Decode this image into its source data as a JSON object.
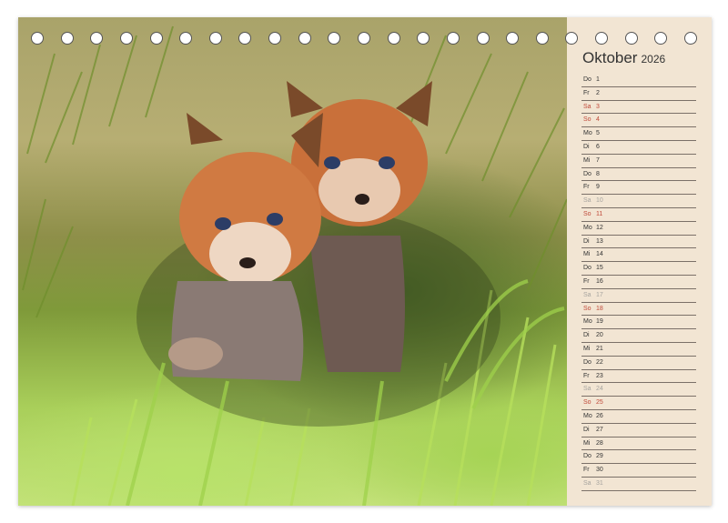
{
  "calendar": {
    "month": "Oktober",
    "year": "2026",
    "days": [
      {
        "name": "Do",
        "num": "1",
        "type": "weekday"
      },
      {
        "name": "Fr",
        "num": "2",
        "type": "weekday"
      },
      {
        "name": "Sa",
        "num": "3",
        "type": "sat"
      },
      {
        "name": "So",
        "num": "4",
        "type": "sun"
      },
      {
        "name": "Mo",
        "num": "5",
        "type": "weekday"
      },
      {
        "name": "Di",
        "num": "6",
        "type": "weekday"
      },
      {
        "name": "Mi",
        "num": "7",
        "type": "weekday"
      },
      {
        "name": "Do",
        "num": "8",
        "type": "weekday"
      },
      {
        "name": "Fr",
        "num": "9",
        "type": "weekday"
      },
      {
        "name": "Sa",
        "num": "10",
        "type": "holiday"
      },
      {
        "name": "So",
        "num": "11",
        "type": "sun"
      },
      {
        "name": "Mo",
        "num": "12",
        "type": "weekday"
      },
      {
        "name": "Di",
        "num": "13",
        "type": "weekday"
      },
      {
        "name": "Mi",
        "num": "14",
        "type": "weekday"
      },
      {
        "name": "Do",
        "num": "15",
        "type": "weekday"
      },
      {
        "name": "Fr",
        "num": "16",
        "type": "weekday"
      },
      {
        "name": "Sa",
        "num": "17",
        "type": "holiday"
      },
      {
        "name": "So",
        "num": "18",
        "type": "sun"
      },
      {
        "name": "Mo",
        "num": "19",
        "type": "weekday"
      },
      {
        "name": "Di",
        "num": "20",
        "type": "weekday"
      },
      {
        "name": "Mi",
        "num": "21",
        "type": "weekday"
      },
      {
        "name": "Do",
        "num": "22",
        "type": "weekday"
      },
      {
        "name": "Fr",
        "num": "23",
        "type": "weekday"
      },
      {
        "name": "Sa",
        "num": "24",
        "type": "holiday"
      },
      {
        "name": "So",
        "num": "25",
        "type": "sun"
      },
      {
        "name": "Mo",
        "num": "26",
        "type": "weekday"
      },
      {
        "name": "Di",
        "num": "27",
        "type": "weekday"
      },
      {
        "name": "Mi",
        "num": "28",
        "type": "weekday"
      },
      {
        "name": "Do",
        "num": "29",
        "type": "weekday"
      },
      {
        "name": "Fr",
        "num": "30",
        "type": "weekday"
      },
      {
        "name": "Sa",
        "num": "31",
        "type": "holiday"
      }
    ]
  },
  "photo": {
    "subject": "two-fox-cubs-icon"
  },
  "colors": {
    "panel": "#f2e5d3",
    "weekend_red": "#c04a3a",
    "muted_grey": "#a7a49f",
    "text": "#333333"
  },
  "binding": {
    "ring_count": 23
  }
}
